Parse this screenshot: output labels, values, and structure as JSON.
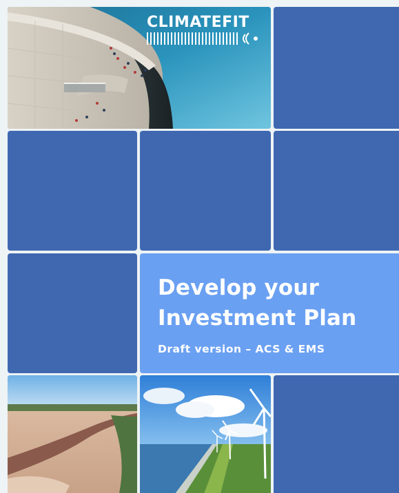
{
  "cover": {
    "logo": {
      "brand": "CLIMATEFIT",
      "icon": "signal-wave-logo-icon"
    },
    "title_lines": [
      "Develop your",
      "Investment Plan"
    ],
    "subtitle": "Draft version – ACS & EMS"
  },
  "photos": [
    {
      "name": "dam-walkway-photo"
    },
    {
      "name": "river-estuary-aerial-photo"
    },
    {
      "name": "wind-turbines-coast-photo"
    }
  ],
  "colors": {
    "background": "#eef3f5",
    "tile_dark_blue": "#3f68b1",
    "tile_light_blue": "#6aa0f2",
    "text": "#ffffff"
  }
}
